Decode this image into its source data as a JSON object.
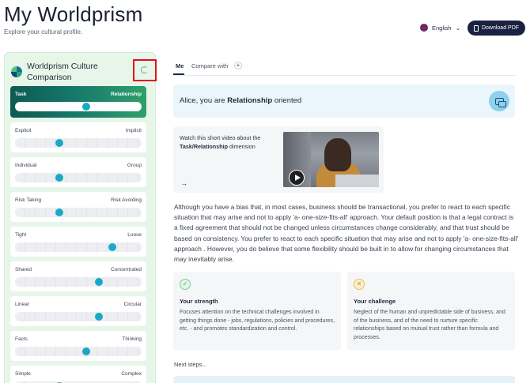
{
  "header": {
    "title": "My Worldprism",
    "subtitle": "Explore your cultural profile.",
    "language": "English",
    "download_label": "Download PDF"
  },
  "panel": {
    "title": "Worldprism Culture Comparison",
    "dimensions": [
      {
        "left": "Task",
        "right": "Relationship",
        "value": 0.56,
        "active": true
      },
      {
        "left": "Explicit",
        "right": "Implicit",
        "value": 0.35
      },
      {
        "left": "Individual",
        "right": "Group",
        "value": 0.35
      },
      {
        "left": "Risk Taking",
        "right": "Risk Avoiding",
        "value": 0.35
      },
      {
        "left": "Tight",
        "right": "Loose",
        "value": 0.77
      },
      {
        "left": "Shared",
        "right": "Concentrated",
        "value": 0.66
      },
      {
        "left": "Linear",
        "right": "Circular",
        "value": 0.66
      },
      {
        "left": "Facts",
        "right": "Thinking",
        "value": 0.56
      },
      {
        "left": "Simple",
        "right": "Complex",
        "value": 0.35
      }
    ]
  },
  "tabs": {
    "me": "Me",
    "compare": "Compare with",
    "plus": "+"
  },
  "orientation": {
    "prefix": "Alice, you are ",
    "dimension": "Relationship",
    "suffix": " oriented"
  },
  "video": {
    "line1": "Watch this short video about the",
    "dimension": "Task/Relationship",
    "line2": " dimension",
    "arrow": "→"
  },
  "description": "Although you have a bias that, in most cases, business should be transactional, you prefer to react to each specific situation that may arise and not to apply 'a- one-size-fits-all' approach. Your default position is that a legal contract is a fixed agreement that should not be changed unless circumstances change considerably, and that trust should be based on consistency. You prefer to react to each specific situation that may arise and not to apply 'a- one-size-fits-all' approach . However, you do believe that some flexibility should be built in to allow for changing circumstances that may inevitably arise.",
  "strength": {
    "badge": "✓",
    "title": "Your strength",
    "body": "Focuses attention on the technical challenges involved in getting things done - jobs, regulations, policies and procedures, etc. - and promotes standardization and control."
  },
  "challenge": {
    "badge": "✕",
    "title": "Your challenge",
    "body": "Neglect of the human and unpredictable side of business, and of the business, and of the need to nurture specific relationships based on mutual trust rather than formula and processes."
  },
  "next_steps": "Next steps..."
}
